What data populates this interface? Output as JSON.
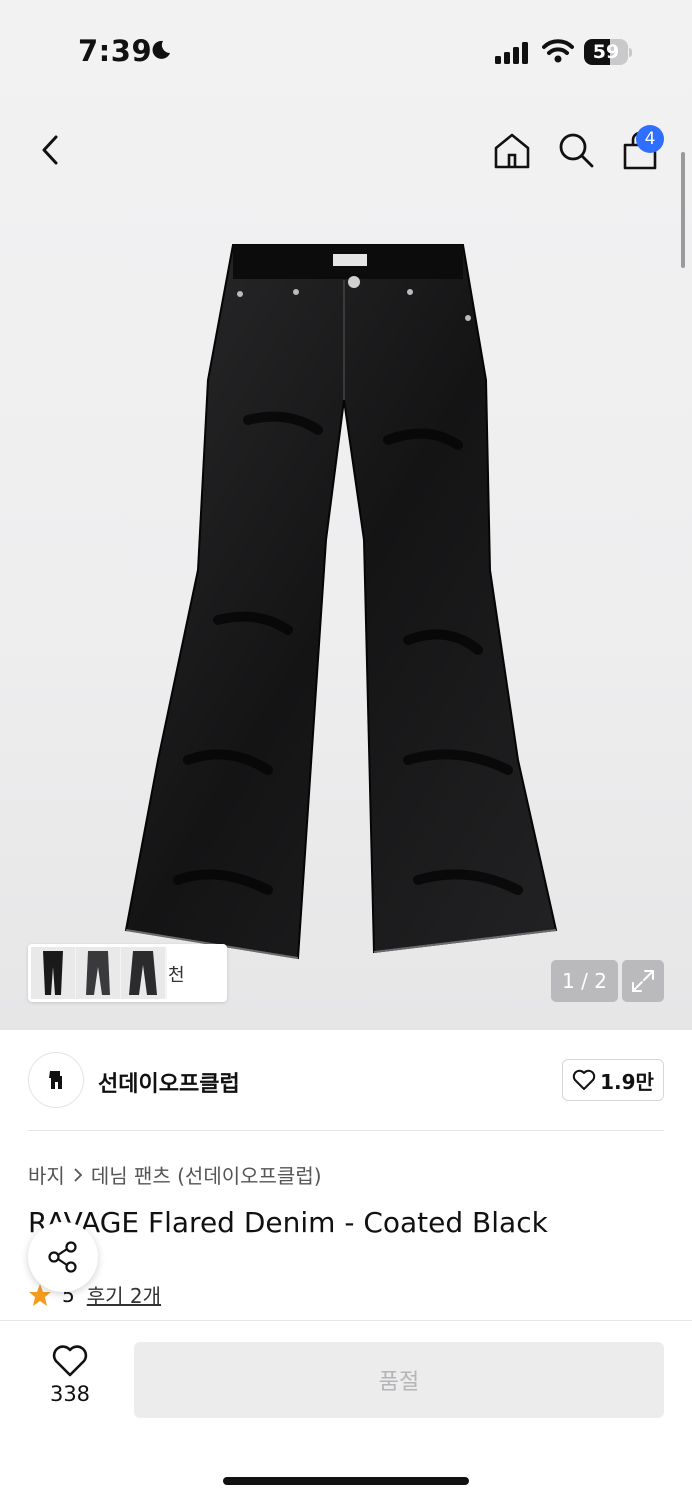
{
  "status_bar": {
    "time": "7:39",
    "battery": "59",
    "battery_level": 0.59,
    "icons": [
      "moon-icon",
      "signal-icon",
      "wifi-icon",
      "battery-icon"
    ]
  },
  "nav": {
    "icons": [
      "back-icon",
      "home-icon",
      "search-icon",
      "cart-icon"
    ],
    "cart_count": "4"
  },
  "gallery": {
    "page_indicator": "1 / 2",
    "recommend_label": "천"
  },
  "brand": {
    "name": "선데이오프클럽",
    "like_count": "1.9만"
  },
  "product": {
    "breadcrumb": [
      "바지",
      "데님 팬츠 (선데이오프클럽)"
    ],
    "title": "RAVAGE Flared Denim - Coated Black",
    "rating": "5",
    "rating_max": 5,
    "review_link": "후기 2개"
  },
  "bottom_bar": {
    "wish_count": "338",
    "cta_label": "품절"
  },
  "colors": {
    "accent": "#2f6fff",
    "disabled_bg": "#ececed",
    "disabled_text": "#b5b5b7",
    "star": "#f39c1f"
  }
}
